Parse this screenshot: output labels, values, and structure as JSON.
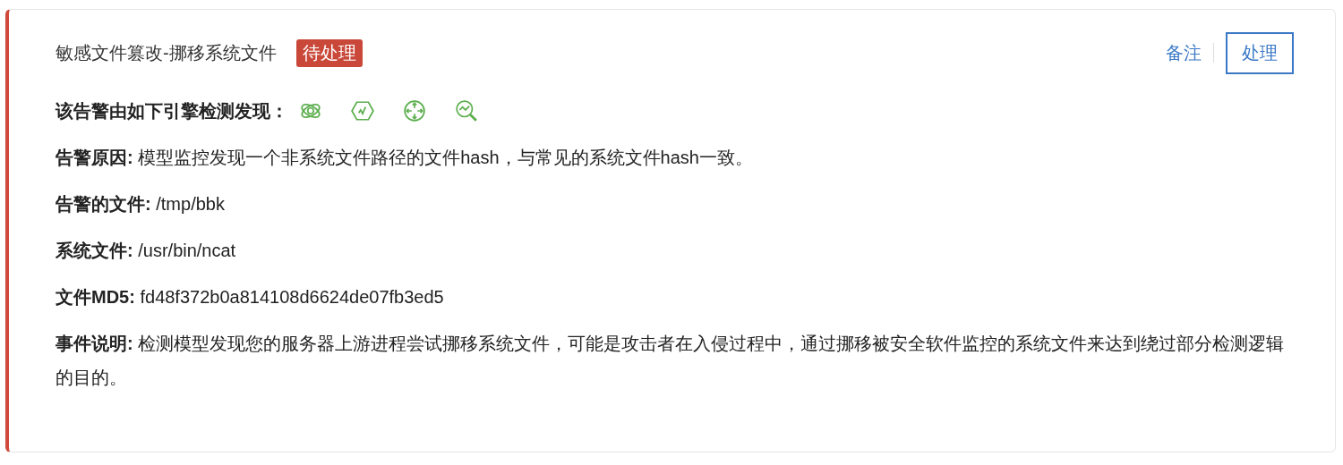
{
  "alert": {
    "title": "敏感文件篡改-挪移系统文件",
    "status": "待处理",
    "actions": [
      {
        "kind": "link",
        "label": "备注"
      },
      {
        "kind": "button",
        "label": "处理"
      }
    ],
    "engines_label": "该告警由如下引擎检测发现：",
    "fields": [
      {
        "label": "告警原因:",
        "value": "模型监控发现一个非系统文件路径的文件hash，与常见的系统文件hash一致。"
      },
      {
        "label": "告警的文件:",
        "value": "/tmp/bbk"
      },
      {
        "label": "系统文件:",
        "value": "/usr/bin/ncat"
      },
      {
        "label": "文件MD5:",
        "value": "fd48f372b0a814108d6624de07fb3ed5"
      },
      {
        "label": "事件说明:",
        "value": "检测模型发现您的服务器上游进程尝试挪移系统文件，可能是攻击者在入侵过程中，通过挪移被安全软件监控的系统文件来达到绕过部分检测逻辑的目的。"
      }
    ]
  }
}
